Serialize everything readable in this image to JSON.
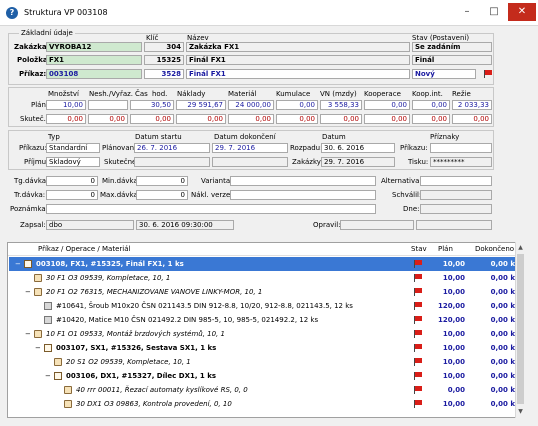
{
  "window": {
    "title": "Struktura VP 003108",
    "icon": "app-icon"
  },
  "header": {
    "section_label": "Základní údaje",
    "col_klic": "Klíč",
    "col_nazev": "Název",
    "col_stav": "Stav (Postavení)",
    "zakazka": {
      "label": "Zakázka:",
      "value": "VYROBA12",
      "key": "304",
      "name": "Zakázka FX1",
      "status": "Se zadáním"
    },
    "polozka": {
      "label": "Položka:",
      "value": "FX1",
      "key": "15325",
      "name": "Finál FX1",
      "status": "Finál"
    },
    "prikaz": {
      "label": "Příkaz:",
      "value": "003108",
      "key": "3528",
      "name": "Finál FX1",
      "status": "Nový"
    }
  },
  "costs": {
    "headers": [
      "Množství",
      "Nesh./Vyřaz.",
      "Čas",
      "hod.",
      "Náklady",
      "Materiál",
      "Kumulace",
      "VN (mzdy)",
      "Kooperace",
      "Koop.int.",
      "Režie"
    ],
    "plan_label": "Plán:",
    "skut_label": "Skuteč.:",
    "plan": [
      "10,00",
      "",
      "30,50",
      "29 591,67",
      "24 000,00",
      "0,00",
      "3 558,33",
      "0,00",
      "0,00",
      "2 033,33"
    ],
    "skut": [
      "0,00",
      "0,00",
      "0,00",
      "0,00",
      "0,00",
      "0,00",
      "0,00",
      "0,00",
      "0,00",
      "0,00"
    ]
  },
  "details": {
    "typ_h": "Typ",
    "datum_startu_h": "Datum startu",
    "datum_dokonceni_h": "Datum dokončení",
    "datum_h": "Datum",
    "priznaky_h": "Příznaky",
    "prikazu_label": "Příkazu:",
    "prikazu_value": "Standardní",
    "planovane_label": "Plánované:",
    "planovane_start": "26. 7. 2016",
    "planovane_end": "29. 7. 2016",
    "rozpadu_label": "Rozpadu:",
    "rozpadu_value": "30. 6. 2016",
    "priznaky_prikazu_label": "Příkazu:",
    "prijmu_label": "Příjmu:",
    "prijmu_value": "Skladový",
    "skutecne_label": "Skutečné:",
    "zakazky_label": "Zakázky:",
    "zakazky_value": "29. 7. 2016",
    "tisku_label": "Tisku:",
    "tisku_value": "*********"
  },
  "misc": {
    "tg_davka_label": "Tg.dávka:",
    "tg_davka_value": "0",
    "min_davka_label": "Min.dávka:",
    "min_davka_value": "0",
    "varianta_label": "Varianta:",
    "alternativa_label": "Alternativa:",
    "tr_davka_label": "Tr.dávka:",
    "tr_davka_value": "0",
    "max_davka_label": "Max.dávka:",
    "max_davka_value": "0",
    "nakl_verze_label": "Nákl. verze:",
    "schvalil_label": "Schválil:",
    "poznamka_label": "Poznámka:",
    "dne_label": "Dne:",
    "zapsal_label": "Zapsal:",
    "zapsal_user": "dbo",
    "zapsal_date": "30. 6. 2016 09:30:00",
    "opravil_label": "Opravil:"
  },
  "tree": {
    "headers": {
      "name": "Příkaz / Operace / Materiál",
      "stav": "Stav",
      "plan": "Plán",
      "dokonceno": "Dokončeno"
    },
    "rows": [
      {
        "text": "003108, FX1, #15325, Finál FX1, 1 ks",
        "plan": "10,00",
        "done": "0,00 k",
        "bold": true,
        "italic": false,
        "selected": true,
        "indent": 0,
        "expander": "−",
        "icon": "order-icon"
      },
      {
        "text": "30 F1 O3 09539, Kompletace, 10, 1",
        "plan": "10,00",
        "done": "0,00 k",
        "bold": false,
        "italic": true,
        "selected": false,
        "indent": 1,
        "expander": "",
        "icon": "operation-icon"
      },
      {
        "text": "20 F1 O2 76315, MECHANIZOVANE VANOVE LINKY-MOR, 10, 1",
        "plan": "10,00",
        "done": "0,00 k",
        "bold": false,
        "italic": true,
        "selected": false,
        "indent": 1,
        "expander": "−",
        "icon": "operation-icon"
      },
      {
        "text": "#10641, Šroub M10x20 ČSN 021143.5 DIN 912-8.8, 10/20, 912-8.8, 021143.5, 12 ks",
        "plan": "120,00",
        "done": "0,00 k",
        "bold": false,
        "italic": false,
        "selected": false,
        "indent": 2,
        "expander": "",
        "icon": "material-icon"
      },
      {
        "text": "#10420, Matice M10 ČSN 021492.2 DIN 985-5, 10, 985-5, 021492.2, 12 ks",
        "plan": "120,00",
        "done": "0,00 k",
        "bold": false,
        "italic": false,
        "selected": false,
        "indent": 2,
        "expander": "",
        "icon": "material-icon"
      },
      {
        "text": "10 F1 O1 09533, Montáž brzdových systémů, 10, 1",
        "plan": "10,00",
        "done": "0,00 k",
        "bold": false,
        "italic": true,
        "selected": false,
        "indent": 1,
        "expander": "−",
        "icon": "operation-icon"
      },
      {
        "text": "003107, SX1, #15326, Sestava SX1, 1 ks",
        "plan": "10,00",
        "done": "0,00 k",
        "bold": true,
        "italic": false,
        "selected": false,
        "indent": 2,
        "expander": "−",
        "icon": "order-icon"
      },
      {
        "text": "20 S1 O2 09539, Kompletace, 10, 1",
        "plan": "10,00",
        "done": "0,00 k",
        "bold": false,
        "italic": true,
        "selected": false,
        "indent": 3,
        "expander": "",
        "icon": "operation-icon"
      },
      {
        "text": "003106, DX1, #15327, Dílec DX1, 1 ks",
        "plan": "10,00",
        "done": "0,00 k",
        "bold": true,
        "italic": false,
        "selected": false,
        "indent": 3,
        "expander": "−",
        "icon": "order-icon"
      },
      {
        "text": "40 rrr 00011, Řezací automaty kyslíkové RS, 0, 0",
        "plan": "0,00",
        "done": "0,00 k",
        "bold": false,
        "italic": true,
        "selected": false,
        "indent": 4,
        "expander": "",
        "icon": "operation-icon"
      },
      {
        "text": "30 DX1 O3 09863, Kontrola provedení, 0, 10",
        "plan": "10,00",
        "done": "0,00 k",
        "bold": false,
        "italic": true,
        "selected": false,
        "indent": 4,
        "expander": "",
        "icon": "operation-icon"
      }
    ]
  },
  "colors": {
    "green_field": "#cfe9cf",
    "selection": "#3a78d4",
    "flag": "#d91e18",
    "number_blue": "#1a1aa0"
  }
}
